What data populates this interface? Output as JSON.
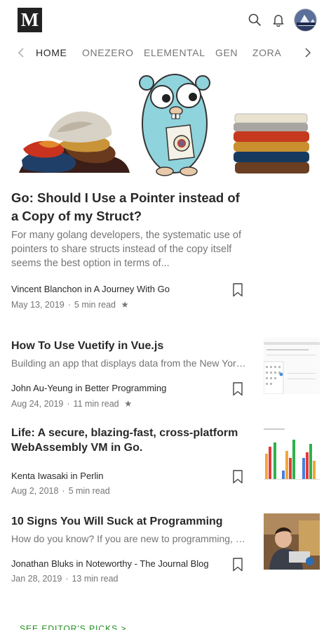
{
  "header": {
    "logo_text": "M",
    "icons": [
      "search-icon",
      "bell-icon"
    ],
    "avatar_label": "user avatar"
  },
  "nav": {
    "items": [
      {
        "label": "HOME",
        "active": true
      },
      {
        "label": "ONEZERO",
        "active": false
      },
      {
        "label": "ELEMENTAL",
        "active": false
      },
      {
        "label": "GEN",
        "active": false
      },
      {
        "label": "ZORA",
        "active": false
      }
    ]
  },
  "hero": {
    "title": "Go: Should I Use a Pointer instead of a Copy of my Struct?",
    "subtitle": "For many golang developers, the systematic use of pointers to share structs instead of the copy itself seems the best option in terms of...",
    "byline": "Vincent Blanchon in A Journey With Go",
    "date": "May 13, 2019",
    "read_time": "5 min read",
    "star": "★"
  },
  "articles": [
    {
      "title": "How To Use Vuetify in Vue.js",
      "subtitle": "Building an app that displays data from the New York Times",
      "byline": "John Au-Yeung in Better Programming",
      "date": "Aug 24, 2019",
      "read_time": "11 min read",
      "star": "★"
    },
    {
      "title": "Life: A secure, blazing-fast, cross-platform WebAssembly VM in Go.",
      "subtitle": "",
      "byline": "Kenta Iwasaki in Perlin",
      "date": "Aug 2, 2018",
      "read_time": "5 min read",
      "star": ""
    },
    {
      "title": "10 Signs You Will Suck at Programming",
      "subtitle": "How do you know? If you are new to programming, it can be hard to tell",
      "byline": "Jonathan Bluks in Noteworthy - The Journal Blog",
      "date": "Jan 28, 2019",
      "read_time": "13 min read",
      "star": ""
    }
  ],
  "footer": {
    "editors_picks": "SEE EDITOR'S PICKS >"
  },
  "colors": {
    "text": "#292929",
    "muted": "#757575",
    "accent_green": "#1a8917"
  }
}
